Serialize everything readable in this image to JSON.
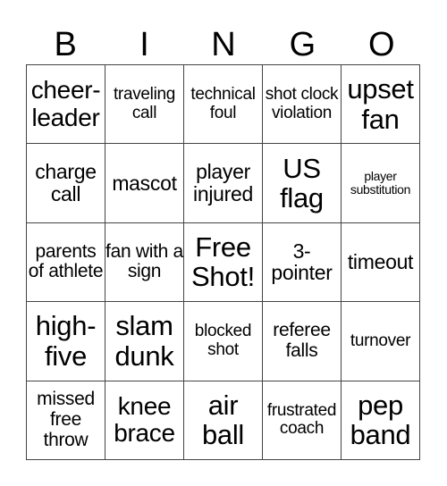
{
  "header": {
    "letters": [
      "B",
      "I",
      "N",
      "G",
      "O"
    ]
  },
  "cells": [
    [
      "cheer-leader",
      "traveling call",
      "technical foul",
      "shot clock violation",
      "upset fan"
    ],
    [
      "charge call",
      "mascot",
      "player injured",
      "US flag",
      "player substitution"
    ],
    [
      "parents of athlete",
      "fan with a sign",
      "Free Shot!",
      "3-pointer",
      "timeout"
    ],
    [
      "high-five",
      "slam dunk",
      "blocked shot",
      "referee falls",
      "turnover"
    ],
    [
      "missed free throw",
      "knee brace",
      "air ball",
      "frustrated coach",
      "pep band"
    ]
  ]
}
